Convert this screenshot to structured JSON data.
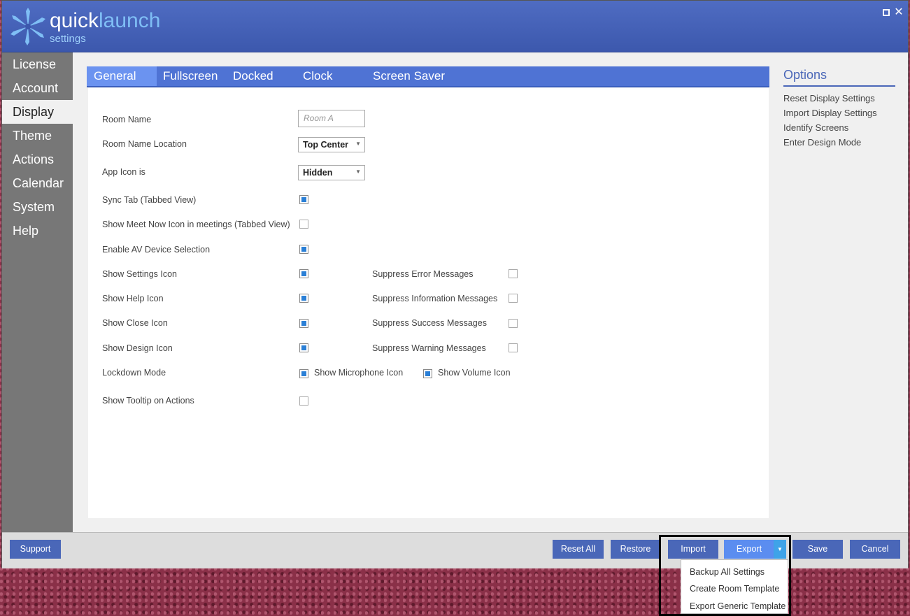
{
  "app": {
    "logo_quick": "quick",
    "logo_launch": "launch",
    "logo_settings": "settings",
    "accent": "#4a67b8"
  },
  "window_controls": {
    "close_glyph": "✕"
  },
  "sidebar": {
    "items": [
      {
        "label": "License"
      },
      {
        "label": "Account"
      },
      {
        "label": "Display"
      },
      {
        "label": "Theme"
      },
      {
        "label": "Actions"
      },
      {
        "label": "Calendar"
      },
      {
        "label": "System"
      },
      {
        "label": "Help"
      }
    ],
    "active": "Display"
  },
  "tabs": [
    {
      "label": "General"
    },
    {
      "label": "Fullscreen"
    },
    {
      "label": "Docked"
    },
    {
      "label": "Clock"
    },
    {
      "label": "Screen Saver"
    }
  ],
  "form": {
    "room_name_label": "Room Name",
    "room_name_placeholder": "Room A",
    "room_name_location_label": "Room Name Location",
    "room_name_location_value": "Top Center",
    "app_icon_label": "App Icon is",
    "app_icon_value": "Hidden",
    "sync_tab_label": "Sync Tab (Tabbed View)",
    "sync_tab_checked": true,
    "meet_now_label": "Show Meet Now Icon in meetings (Tabbed View)",
    "meet_now_checked": false,
    "av_device_label": "Enable AV Device Selection",
    "av_device_checked": true,
    "settings_icon_label": "Show Settings Icon",
    "settings_icon_checked": true,
    "help_icon_label": "Show Help Icon",
    "help_icon_checked": true,
    "close_icon_label": "Show Close Icon",
    "close_icon_checked": true,
    "design_icon_label": "Show Design Icon",
    "design_icon_checked": true,
    "lockdown_label": "Lockdown Mode",
    "lockdown_checked": true,
    "microphone_label": "Show Microphone Icon",
    "volume_label": "Show Volume Icon",
    "volume_checked": true,
    "tooltip_label": "Show Tooltip on Actions",
    "tooltip_checked": false,
    "suppress_error_label": "Suppress Error Messages",
    "suppress_info_label": "Suppress Information Messages",
    "suppress_success_label": "Suppress Success Messages",
    "suppress_warning_label": "Suppress Warning Messages"
  },
  "options": {
    "title": "Options",
    "links": [
      {
        "label": "Reset Display Settings"
      },
      {
        "label": "Import Display Settings"
      },
      {
        "label": "Identify Screens"
      },
      {
        "label": "Enter Design Mode"
      }
    ]
  },
  "footer": {
    "support": "Support",
    "reset_all": "Reset All",
    "restore": "Restore",
    "import": "Import",
    "export": "Export",
    "save": "Save",
    "cancel": "Cancel"
  },
  "export_menu": {
    "items": [
      {
        "label": "Backup All Settings"
      },
      {
        "label": "Create Room Template"
      },
      {
        "label": "Export Generic Template"
      }
    ]
  }
}
